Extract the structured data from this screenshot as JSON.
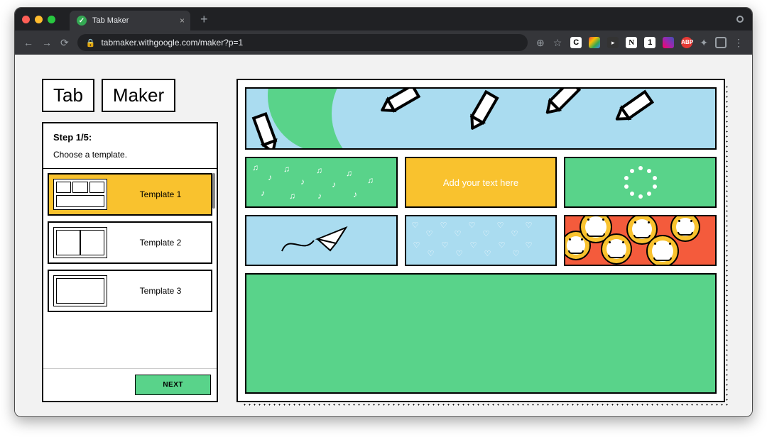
{
  "browser": {
    "tab_title": "Tab Maker",
    "url": "tabmaker.withgoogle.com/maker?p=1"
  },
  "logo": {
    "word1": "Tab",
    "word2": "Maker"
  },
  "step": {
    "title": "Step 1/5:",
    "subtitle": "Choose a template."
  },
  "templates": [
    {
      "label": "Template 1",
      "selected": true
    },
    {
      "label": "Template 2",
      "selected": false
    },
    {
      "label": "Template 3",
      "selected": false
    }
  ],
  "next_button": "NEXT",
  "preview": {
    "placeholder_text": "Add your text here"
  }
}
